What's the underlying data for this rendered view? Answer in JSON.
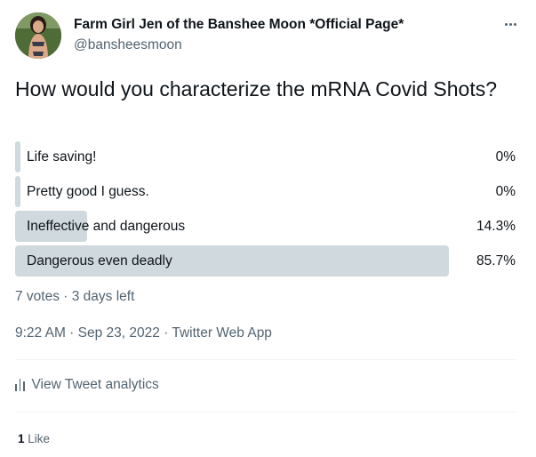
{
  "author": {
    "display_name": "Farm Girl Jen of the Banshee Moon *Official Page*",
    "handle": "@bansheesmoon"
  },
  "question": "How would you characterize the mRNA Covid Shots?",
  "poll": {
    "options": [
      {
        "label": "Life saving!",
        "percent": "0%",
        "value": 0
      },
      {
        "label": "Pretty good I guess.",
        "percent": "0%",
        "value": 0
      },
      {
        "label": "Ineffective and dangerous",
        "percent": "14.3%",
        "value": 14.3
      },
      {
        "label": "Dangerous even deadly",
        "percent": "85.7%",
        "value": 85.7
      }
    ],
    "meta": "7 votes · 3 days left"
  },
  "timestamp": "9:22 AM · Sep 23, 2022 · Twitter Web App",
  "analytics_label": "View Tweet analytics",
  "likes": {
    "count": "1",
    "label": "Like"
  },
  "colors": {
    "text": "#0f1419",
    "secondary": "#536471",
    "bar": "#cfd9de",
    "divider": "#eff3f4"
  },
  "icons": {
    "more": "more-horizontal-icon",
    "analytics": "analytics-icon"
  }
}
